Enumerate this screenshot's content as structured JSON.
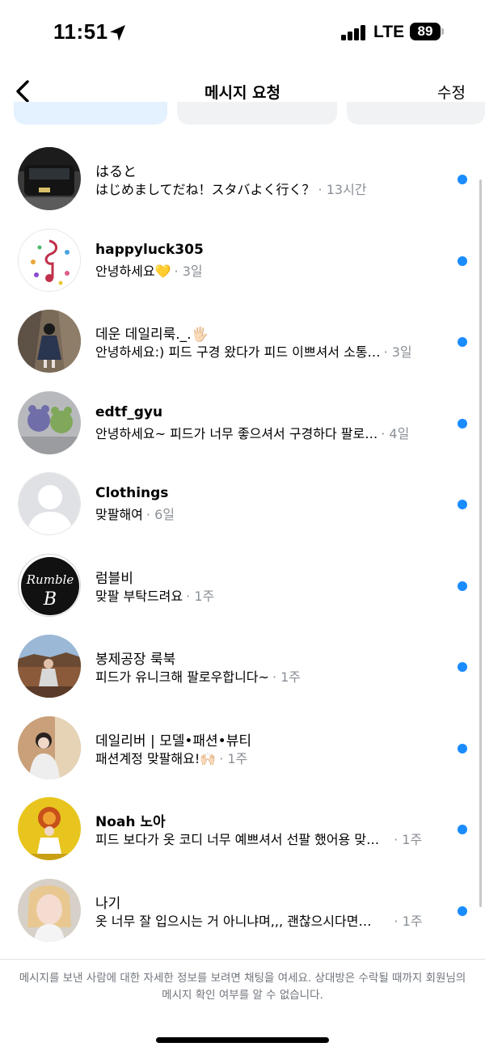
{
  "status_bar": {
    "time": "11:51",
    "network": "LTE",
    "battery": "89"
  },
  "header": {
    "title": "메시지 요청",
    "edit_label": "수정"
  },
  "requests": [
    {
      "name": "はると",
      "message": "はじめましてだね！スタバよく行く？",
      "time": "· 13시간",
      "avatar_icon": "car-photo-avatar"
    },
    {
      "name": "happyluck305",
      "message": "안녕하세요💛",
      "time": "· 3일",
      "avatar_icon": "music-notes-avatar"
    },
    {
      "name": "데운 데일리룩._.🖐🏻",
      "message": "안녕하세요:) 피드 구경 왔다가 피드 이쁘셔서 소통…",
      "time": "· 3일",
      "avatar_icon": "person-photo-avatar"
    },
    {
      "name": "edtf_gyu",
      "message": "안녕하세요~  피드가 너무 좋으셔서 구경하다 팔로…",
      "time": "· 4일",
      "avatar_icon": "plush-toys-avatar"
    },
    {
      "name": "Clothings",
      "message": "맞팔해여",
      "time": "· 6일",
      "avatar_icon": "default-user-avatar"
    },
    {
      "name": "럼블비",
      "message": "맞팔 부탁드려요",
      "time": "· 1주",
      "avatar_icon": "rumble-logo-avatar"
    },
    {
      "name": "봉제공장 룩북",
      "message": "피드가 유니크해 팔로우합니다~",
      "time": "· 1주",
      "avatar_icon": "person-photo-avatar"
    },
    {
      "name": "데일리버 | 모델•패션•뷰티",
      "message": "패션계정 맞팔해요!🙌🏻",
      "time": "· 1주",
      "avatar_icon": "person-photo-avatar"
    },
    {
      "name": "Noah 노아",
      "message": "피드 보다가 옷 코디 너무 예쁘셔서 선팔 했어용 맞…",
      "time": "· 1주",
      "avatar_icon": "person-photo-avatar"
    },
    {
      "name": "나기",
      "message": "옷 너무 잘 입으시는 거 아니냐며,,, 괜찮으시다면…",
      "time": "· 1주",
      "avatar_icon": "person-photo-avatar"
    }
  ],
  "rumble_logo": {
    "line1": "Rumble",
    "line2": "B"
  },
  "footer": {
    "note": "메시지를 보낸 사람에 대한 자세한 정보를 보려면 채팅을 여세요. 상대방은 수락될 때까지 회원님의 메시지 확인 여부를 알 수 없습니다."
  },
  "colors": {
    "unread_dot": "#1a8cff",
    "muted_text": "#8a8f96",
    "active_chip": "#e4f1ff"
  }
}
